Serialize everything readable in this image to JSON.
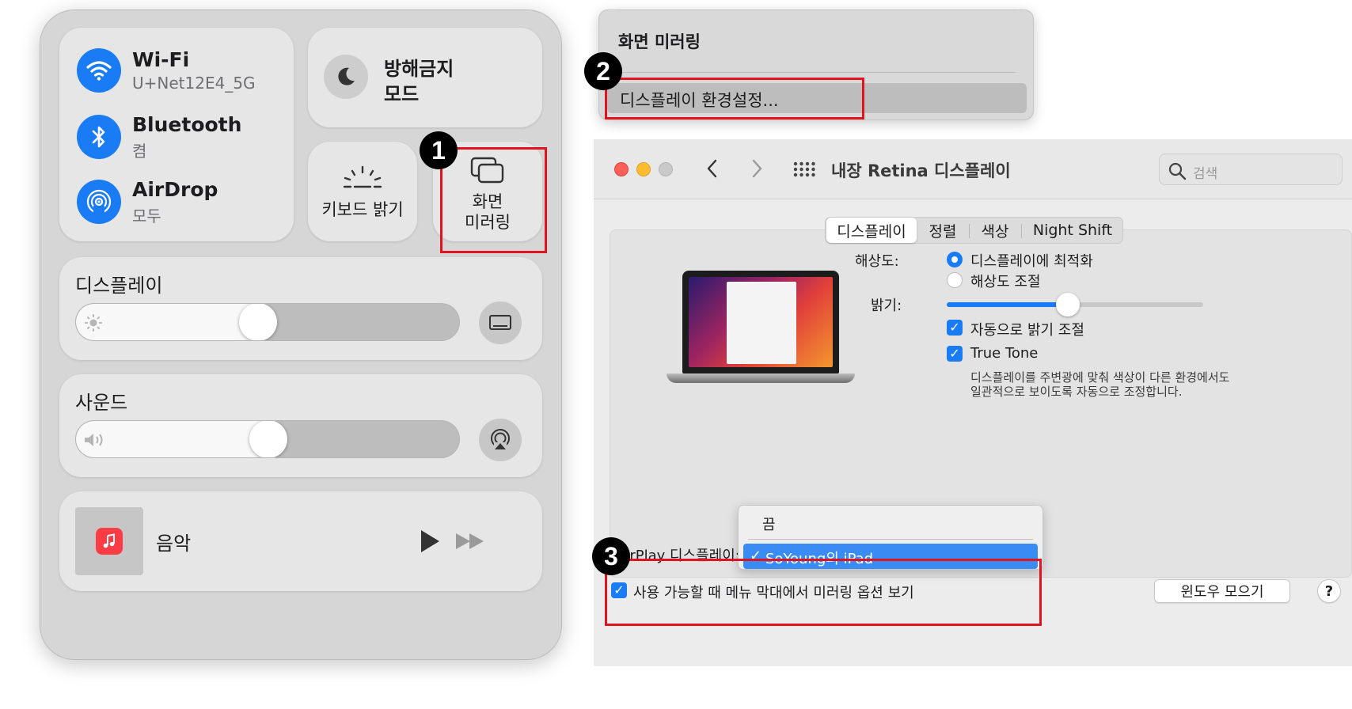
{
  "control_center": {
    "wifi": {
      "title": "Wi-Fi",
      "subtitle": "U+Net12E4_5G"
    },
    "bluetooth": {
      "title": "Bluetooth",
      "subtitle": "켬"
    },
    "airdrop": {
      "title": "AirDrop",
      "subtitle": "모두"
    },
    "focus": {
      "title_line1": "방해금지",
      "title_line2": "모드"
    },
    "keyboard_brightness": {
      "label": "키보드 밝기"
    },
    "screen_mirroring": {
      "line1": "화면",
      "line2": "미러링"
    },
    "display": {
      "title": "디스플레이",
      "level": 0.47
    },
    "sound": {
      "title": "사운드",
      "level": 0.5
    },
    "music": {
      "title": "음악"
    }
  },
  "mirroring_menu": {
    "title": "화면 미러링",
    "item": "디스플레이 환경설정..."
  },
  "prefs_window": {
    "title": "내장 Retina 디스플레이",
    "search_placeholder": "검색",
    "tabs": [
      "디스플레이",
      "정렬",
      "색상",
      "Night Shift"
    ],
    "selected_tab": "디스플레이",
    "resolution_label": "해상도:",
    "resolution_options": [
      "디스플레이에 최적화",
      "해상도 조절"
    ],
    "brightness_label": "밝기:",
    "brightness_level": 0.47,
    "auto_brightness": "자동으로 밝기 조절",
    "true_tone": "True Tone",
    "true_tone_desc_line1": "디스플레이를 주변광에 맞춰 색상이 다른 환경에서도",
    "true_tone_desc_line2": "일관적으로 보이도록 자동으로 조정합니다.",
    "airplay_label": "AirPlay 디스플레이:",
    "airplay_options": [
      "끔",
      "SoYoung의 iPad"
    ],
    "airplay_selected": "SoYoung의 iPad",
    "show_mirroring_option": "사용 가능할 때 메뉴 막대에서 미러링 옵션 보기",
    "gather_windows": "윈도우 모으기",
    "help": "?",
    "check_mark": "✓"
  },
  "annotations": [
    "1",
    "2",
    "3"
  ],
  "colors": {
    "accent": "#1a7cf5",
    "annotation_red": "#e0141e",
    "music_red": "#fc3c44"
  }
}
